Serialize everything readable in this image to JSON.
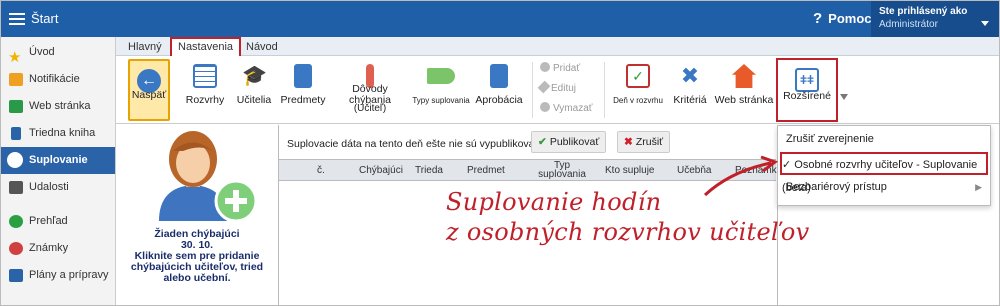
{
  "topbar": {
    "title": "Štart",
    "help": "Pomoc",
    "user_line1": "Ste prihlásený ako",
    "user_line2": "Administrátor"
  },
  "sidebar": {
    "items": [
      {
        "label": "Úvod",
        "icon": "star-icon",
        "color": "#f0b400"
      },
      {
        "label": "Notifikácie",
        "icon": "envelope-icon",
        "color": "#f0a020"
      },
      {
        "label": "Web stránka",
        "icon": "home-icon",
        "color": "#2a9a4a"
      },
      {
        "label": "Triedna kniha",
        "icon": "book-icon",
        "color": "#2a63a8"
      },
      {
        "label": "Suplovanie",
        "icon": "user-icon",
        "color": "#ffffff"
      },
      {
        "label": "Udalosti",
        "icon": "calendar-icon",
        "color": "#555555"
      },
      {
        "label": "Prehľad",
        "icon": "check-circle-icon",
        "color": "#2aa040"
      },
      {
        "label": "Známky",
        "icon": "grade-icon",
        "color": "#d04040"
      },
      {
        "label": "Plány a prípravy",
        "icon": "folder-icon",
        "color": "#2a63a8"
      }
    ]
  },
  "tabs": [
    "Hlavný",
    "Nastavenia",
    "Návod"
  ],
  "toolbar": {
    "back": "Naspäť",
    "schedules": "Rozvrhy",
    "teachers": "Učitelia",
    "subjects": "Predmety",
    "reasons_l1": "Dôvody chýbania",
    "reasons_l2": "(Učiteľ)",
    "types": "Typy suplovania",
    "approbation": "Aprobácia",
    "add": "Pridať",
    "edit": "Edituj",
    "delete": "Vymazať",
    "day_schedule": "Deň v rozvrhu",
    "criteria": "Kritériá",
    "website": "Web stránka",
    "advanced": "Rozšírené"
  },
  "left_panel": {
    "line1": "Žiaden chýbajúci",
    "line2": "30. 10.",
    "line3": "Kliknite sem pre pridanie",
    "line4": "chýbajúcich učiteľov, tried",
    "line5": "alebo učební."
  },
  "center": {
    "message": "Suplovacie dáta na tento deň ešte nie sú vypublikované.",
    "publish": "Publikovať",
    "cancel": "Zrušiť"
  },
  "table": {
    "col_num": "č.",
    "col_missing": "Chýbajúci",
    "col_class": "Trieda",
    "col_subject": "Predmet",
    "col_type_l1": "Typ",
    "col_type_l2": "suplovania",
    "col_who": "Kto supluje",
    "col_room": "Učebňa",
    "col_note": "Poznámka"
  },
  "dropdown": {
    "item1": "Zrušiť zverejnenie",
    "item2": "✓ Osobné rozvrhy učiteľov - Suplovanie (beta)",
    "item3": "Bezbariérový prístup",
    "submenu": "▶"
  },
  "annotation": {
    "line1": "Suplovanie hodín",
    "line2": "z osobných rozvrhov učiteľov"
  }
}
